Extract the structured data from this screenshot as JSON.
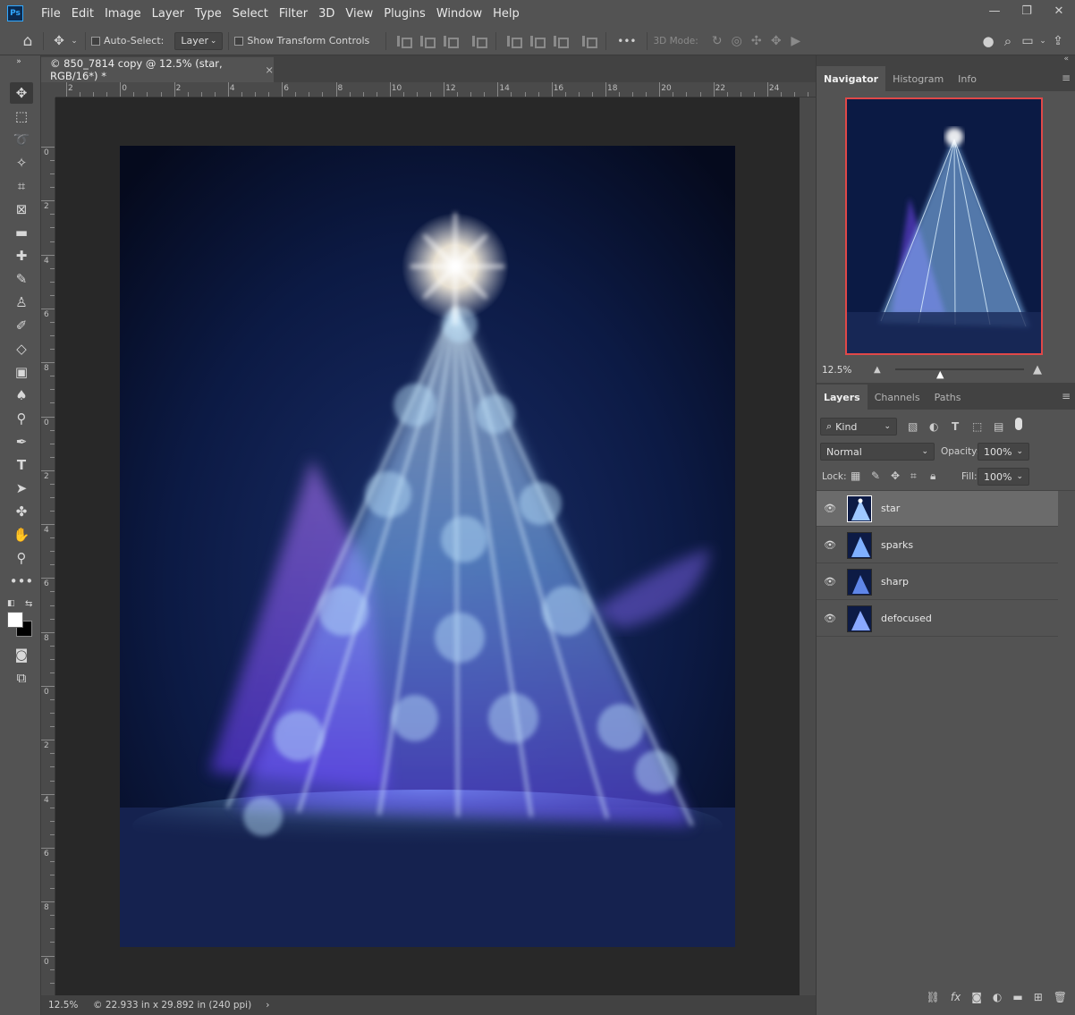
{
  "app": {
    "logo": "Ps"
  },
  "menu": [
    "File",
    "Edit",
    "Image",
    "Layer",
    "Type",
    "Select",
    "Filter",
    "3D",
    "View",
    "Plugins",
    "Window",
    "Help"
  ],
  "window_controls": {
    "minimize": "—",
    "restore": "❐",
    "close": "✕"
  },
  "options": {
    "auto_select_label": "Auto-Select:",
    "auto_select_value": "Layer",
    "transform_controls_label": "Show Transform Controls",
    "more": "•••",
    "mode_3d_label": "3D Mode:"
  },
  "document": {
    "tab_title": "© 850_7814 copy @ 12.5% (star, RGB/16*) *",
    "close": "×"
  },
  "rulers": {
    "top": [
      "2",
      "0",
      "2",
      "4",
      "6",
      "8",
      "10",
      "12",
      "14",
      "16",
      "18",
      "20",
      "22",
      "24"
    ],
    "left": [
      "0",
      "2",
      "4",
      "6",
      "8",
      "0",
      "2",
      "4",
      "6",
      "8",
      "0",
      "2",
      "4",
      "6",
      "8",
      "0"
    ]
  },
  "status": {
    "zoom": "12.5%",
    "info": "© 22.933 in x 29.892 in (240 ppi)",
    "arrow": "›"
  },
  "navigator": {
    "tabs": [
      "Navigator",
      "Histogram",
      "Info"
    ],
    "zoom": "12.5%"
  },
  "layers_panel": {
    "tabs": [
      "Layers",
      "Channels",
      "Paths"
    ],
    "filter_kind": "Kind",
    "blend_mode": "Normal",
    "opacity_label": "Opacity:",
    "opacity_value": "100%",
    "lock_label": "Lock:",
    "fill_label": "Fill:",
    "fill_value": "100%",
    "layers": [
      {
        "name": "star",
        "selected": true
      },
      {
        "name": "sparks",
        "selected": false
      },
      {
        "name": "sharp",
        "selected": false
      },
      {
        "name": "defocused",
        "selected": false
      }
    ]
  },
  "colors": {
    "ui_bg": "#535353",
    "accent_red": "#e04848",
    "ps_blue": "#31a8ff",
    "art_glow": "#9fd8ff",
    "art_violet": "#8a5cff"
  }
}
